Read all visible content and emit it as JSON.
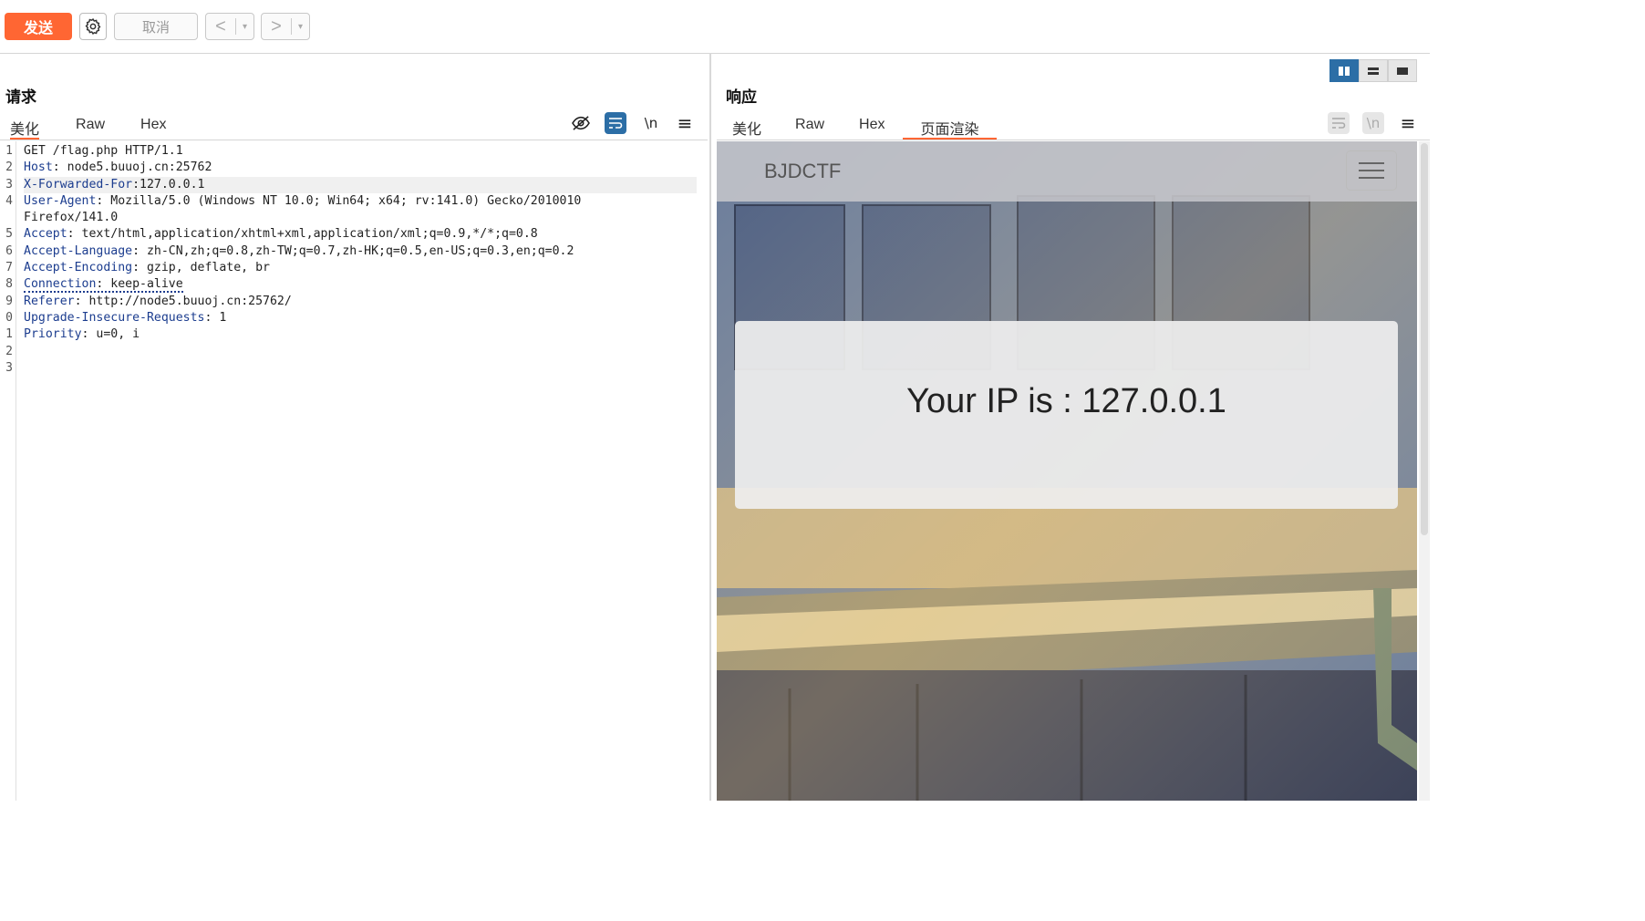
{
  "toolbar": {
    "send_label": "发送",
    "cancel_label": "取消",
    "back_arrow": "<",
    "forward_arrow": ">",
    "dropdown_glyph": "▾"
  },
  "request": {
    "title": "请求",
    "tabs": [
      {
        "label": "美化",
        "active": true
      },
      {
        "label": "Raw",
        "active": false
      },
      {
        "label": "Hex",
        "active": false
      }
    ],
    "tools": {
      "newline": "\\n",
      "menu": "≡"
    },
    "line_numbers": [
      "1",
      "2",
      "3",
      "4",
      "",
      "5",
      "6",
      "7",
      "8",
      "9",
      "0",
      "1",
      "2",
      "3"
    ],
    "lines": [
      {
        "key": "",
        "value": "GET /flag.php HTTP/1.1"
      },
      {
        "key": "Host",
        "value": ": node5.buuoj.cn:25762"
      },
      {
        "key": "X-Forwarded-For",
        "value": ":127.0.0.1"
      },
      {
        "key": "User-Agent",
        "value": ": Mozilla/5.0 (Windows NT 10.0; Win64; x64; rv:141.0) Gecko/2010010"
      },
      {
        "key": "",
        "value": "Firefox/141.0"
      },
      {
        "key": "Accept",
        "value": ": text/html,application/xhtml+xml,application/xml;q=0.9,*/*;q=0.8"
      },
      {
        "key": "Accept-Language",
        "value": ": zh-CN,zh;q=0.8,zh-TW;q=0.7,zh-HK;q=0.5,en-US;q=0.3,en;q=0.2"
      },
      {
        "key": "Accept-Encoding",
        "value": ": gzip, deflate, br"
      },
      {
        "key": "Connection",
        "value": ": keep-alive"
      },
      {
        "key": "Referer",
        "value": ": http://node5.buuoj.cn:25762/"
      },
      {
        "key": "Upgrade-Insecure-Requests",
        "value": ": 1"
      },
      {
        "key": "Priority",
        "value": ": u=0, i"
      },
      {
        "key": "",
        "value": ""
      },
      {
        "key": "",
        "value": ""
      }
    ]
  },
  "response": {
    "title": "响应",
    "tabs": [
      {
        "label": "美化",
        "active": false
      },
      {
        "label": "Raw",
        "active": false
      },
      {
        "label": "Hex",
        "active": false
      },
      {
        "label": "页面渲染",
        "active": true
      }
    ],
    "tools": {
      "newline": "\\n",
      "menu": "≡"
    },
    "rendered": {
      "brand": "BJDCTF",
      "message": "Your IP is : 127.0.0.1"
    }
  },
  "colors": {
    "accent": "#ff6633",
    "active_tool": "#2c6ea6",
    "header_key": "#1c3d8f"
  }
}
